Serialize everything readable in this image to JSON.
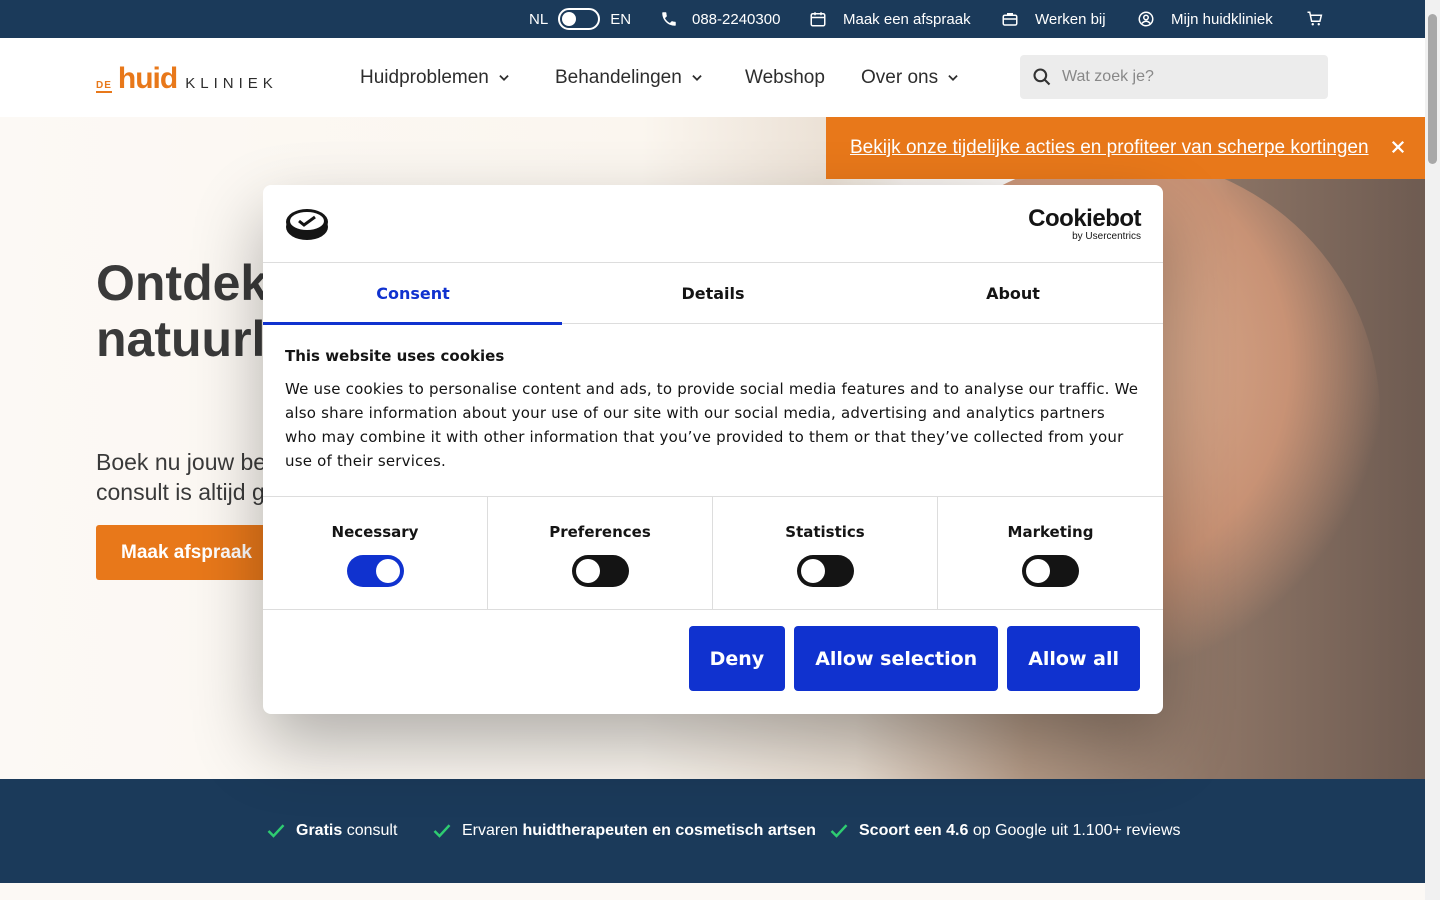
{
  "topbar": {
    "lang_nl": "NL",
    "lang_en": "EN",
    "phone": "088-2240300",
    "appointment": "Maak een afspraak",
    "jobs": "Werken bij",
    "account": "Mijn huidkliniek"
  },
  "logo": {
    "de": "DE",
    "huid": "huid",
    "kliniek": "KLINIEK"
  },
  "nav": {
    "items": [
      {
        "label": "Huidproblemen"
      },
      {
        "label": "Behandelingen"
      },
      {
        "label": "Webshop"
      },
      {
        "label": "Over ons"
      }
    ]
  },
  "search": {
    "placeholder": "Wat zoek je?"
  },
  "promo": {
    "text": "Bekijk onze tijdelijke acties en profiteer van scherpe kortingen"
  },
  "hero": {
    "title_line1": "Ontdek",
    "title_line2": "natuurli",
    "sub_line1": "Boek nu jouw be",
    "sub_line2": "consult is altijd g",
    "cta": "Maak afspraak"
  },
  "usp": {
    "u1_bold": "Gratis",
    "u1_rest": " consult",
    "u2_pre": "Ervaren ",
    "u2_bold": "huidtherapeuten en cosmetisch artsen",
    "u3_bold": "Scoort een 4.6",
    "u3_rest": " op Google uit 1.100+ reviews"
  },
  "cookie_dialog": {
    "brand": "Cookiebot",
    "brand_sub": "by Usercentrics",
    "tabs": [
      "Consent",
      "Details",
      "About"
    ],
    "heading": "This website uses cookies",
    "body": "We use cookies to personalise content and ads, to provide social media features and to analyse our traffic. We also share information about your use of our site with our social media, advertising and analytics partners who may combine it with other information that you’ve provided to them or that they’ve collected from your use of their services.",
    "categories": [
      {
        "label": "Necessary",
        "enabled": true
      },
      {
        "label": "Preferences",
        "enabled": false
      },
      {
        "label": "Statistics",
        "enabled": false
      },
      {
        "label": "Marketing",
        "enabled": false
      }
    ],
    "buttons": {
      "deny": "Deny",
      "allow_selection": "Allow selection",
      "allow_all": "Allow all"
    }
  },
  "colors": {
    "navy": "#1b3a5a",
    "orange": "#e8781a",
    "cookiebot_blue": "#1032cf",
    "check_green": "#2ecc71"
  }
}
